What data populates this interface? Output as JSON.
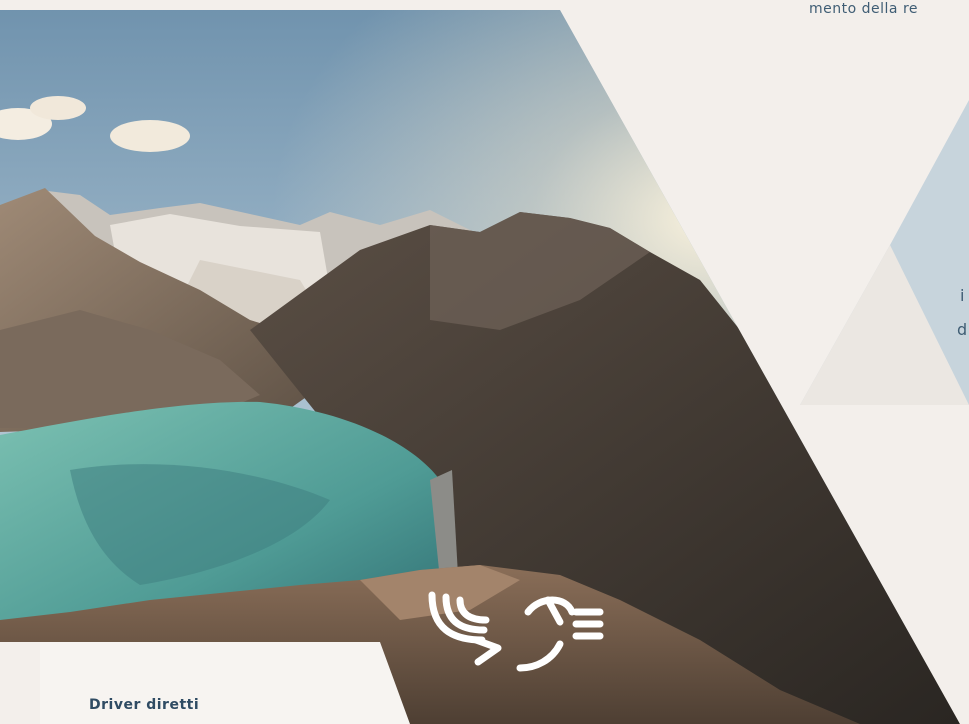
{
  "texts": {
    "top_right": "mento della re",
    "side_1": "i",
    "side_2": "d",
    "driver_label": "Driver diretti"
  },
  "logo": {
    "icon": "chevron-hand-logo"
  },
  "colors": {
    "background": "#f3efeb",
    "panel_blue": "#c7d4dc",
    "text_blue": "#3f5d74"
  }
}
